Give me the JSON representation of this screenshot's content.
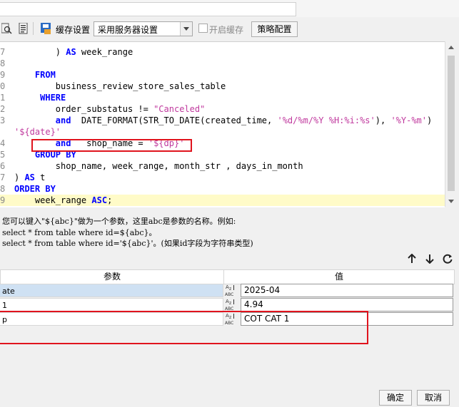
{
  "toolbar": {
    "cache_setting_label": "缓存设置",
    "cache_setting_value": "采用服务器设置",
    "enable_cache_label": "开启缓存",
    "strategy_button": "策略配置"
  },
  "editor": {
    "lines": [
      {
        "no": "7",
        "code": [
          {
            "t": "        ) ",
            "c": ""
          },
          {
            "t": "AS",
            "c": "kw"
          },
          {
            "t": " week_range",
            "c": ""
          }
        ]
      },
      {
        "no": "8",
        "code": []
      },
      {
        "no": "9",
        "code": [
          {
            "t": "    ",
            "c": ""
          },
          {
            "t": "FROM",
            "c": "kw"
          }
        ]
      },
      {
        "no": "0",
        "code": [
          {
            "t": "        business_review_store_sales_table",
            "c": ""
          }
        ]
      },
      {
        "no": "1",
        "code": [
          {
            "t": "     ",
            "c": ""
          },
          {
            "t": "WHERE",
            "c": "kw"
          }
        ]
      },
      {
        "no": "2",
        "code": [
          {
            "t": "        order_substatus != ",
            "c": ""
          },
          {
            "t": "\"Canceled\"",
            "c": "str"
          }
        ]
      },
      {
        "no": "3",
        "code": [
          {
            "t": "        ",
            "c": ""
          },
          {
            "t": "and",
            "c": "kw"
          },
          {
            "t": "  DATE_FORMAT(STR_TO_DATE(created_time, ",
            "c": ""
          },
          {
            "t": "'%d/%m/%Y %H:%i:%s'",
            "c": "str"
          },
          {
            "t": "), ",
            "c": ""
          },
          {
            "t": "'%Y-%m'",
            "c": "str"
          },
          {
            "t": ")   =",
            "c": ""
          }
        ]
      },
      {
        "no": "",
        "code": [
          {
            "t": "'${date}'",
            "c": "str"
          }
        ]
      },
      {
        "no": "4",
        "code": [
          {
            "t": "        ",
            "c": ""
          },
          {
            "t": "and",
            "c": "kw"
          },
          {
            "t": "   shop_name = ",
            "c": ""
          },
          {
            "t": "'${dp}'",
            "c": "str"
          }
        ]
      },
      {
        "no": "5",
        "code": [
          {
            "t": "    ",
            "c": ""
          },
          {
            "t": "GROUP BY",
            "c": "kw"
          }
        ]
      },
      {
        "no": "6",
        "code": [
          {
            "t": "        shop_name, week_range, month_str , days_in_month",
            "c": ""
          }
        ]
      },
      {
        "no": "7",
        "code": [
          {
            "t": ") ",
            "c": ""
          },
          {
            "t": "AS",
            "c": "kw"
          },
          {
            "t": " t",
            "c": ""
          }
        ]
      },
      {
        "no": "8",
        "code": [
          {
            "t": "ORDER BY",
            "c": "kw"
          }
        ]
      },
      {
        "no": "9",
        "code": [
          {
            "t": "    week_range ",
            "c": ""
          },
          {
            "t": "ASC",
            "c": "kw"
          },
          {
            "t": ";",
            "c": ""
          }
        ]
      }
    ]
  },
  "hint": {
    "line1": "您可以键入\"${abc}\"做为一个参数，这里abc是参数的名称。例如:",
    "line2": "select * from table where id=${abc}。",
    "line3": "select * from table where id='${abc}'。(如果id字段为字符串类型)"
  },
  "params": {
    "header_name": "参数",
    "header_value": "值",
    "rows": [
      {
        "name": "ate",
        "value": "2025-04"
      },
      {
        "name": "1",
        "value": "4.94"
      },
      {
        "name": "p",
        "value": "COT CAT 1"
      }
    ]
  },
  "footer": {
    "ok_button": "确定",
    "cancel_button": "取消"
  },
  "colors": {
    "keyword": "#0000ff",
    "string": "#c0399e",
    "highlight": "#fffbc8",
    "annotation_red": "#e0141e"
  }
}
